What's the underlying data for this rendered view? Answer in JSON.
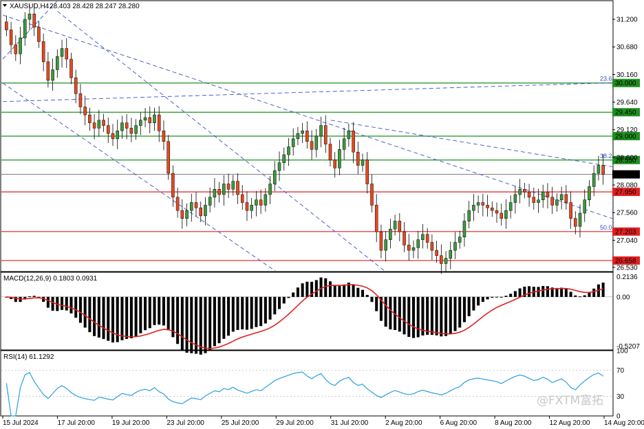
{
  "header": {
    "symbol": "XAUSUD,H4",
    "ohlc": "28.403 28.428 28.247 28.280"
  },
  "watermark": "@FXTM富拓",
  "colors": {
    "bull": "#3c9a3c",
    "bear": "#e8491f",
    "horizontal_line": "#e02020",
    "green_level": "#1f8f1f",
    "trend_dash": "#3a4fc8",
    "macd_signal": "#e02020",
    "rsi_line": "#2a9fe0"
  },
  "chart_data": [
    {
      "type": "candlestick",
      "panel": "price",
      "ylim": [
        26.45,
        31.55
      ],
      "price_ticks": [
        "31.200",
        "30.680",
        "30.160",
        "29.640",
        "29.120",
        "28.600",
        "28.080",
        "27.560",
        "27.040",
        "26.530"
      ],
      "x_labels": [
        "15 Jul 2024",
        "17 Jul 20:00",
        "19 Jul 20:00",
        "23 Jul 20:00",
        "25 Jul 20:00",
        "29 Jul 20:00",
        "31 Jul 20:00",
        "2 Aug 20:00",
        "6 Aug 20:00",
        "8 Aug 20:00",
        "12 Aug 20:00",
        "14 Aug 20:00"
      ],
      "current_price": {
        "value": 28.28,
        "label": "28.280"
      },
      "levels": [
        {
          "value": 30.0,
          "label": "30.000",
          "color": "green",
          "note": "23.6"
        },
        {
          "value": 29.45,
          "label": "29.450",
          "color": "green"
        },
        {
          "value": 29.0,
          "label": "29.000",
          "color": "green"
        },
        {
          "value": 28.55,
          "label": "28.550",
          "color": "green",
          "note": "38.2"
        },
        {
          "value": 27.95,
          "label": "27.950",
          "color": "red"
        },
        {
          "value": 27.203,
          "label": "27.203",
          "color": "red",
          "note": "50.0"
        },
        {
          "value": 26.658,
          "label": "26.658",
          "color": "red"
        }
      ],
      "candle_closes": [
        31.0,
        30.72,
        30.55,
        30.85,
        31.2,
        31.3,
        31.05,
        30.78,
        30.4,
        30.05,
        30.25,
        30.5,
        30.65,
        30.45,
        30.1,
        29.8,
        29.55,
        29.4,
        29.25,
        29.15,
        29.3,
        29.2,
        29.05,
        28.95,
        29.1,
        29.25,
        29.15,
        29.05,
        29.2,
        29.3,
        29.35,
        29.25,
        29.4,
        29.1,
        28.9,
        28.3,
        27.85,
        27.6,
        27.45,
        27.6,
        27.75,
        27.65,
        27.5,
        27.7,
        27.85,
        28.0,
        27.9,
        28.1,
        28.0,
        28.15,
        27.9,
        27.75,
        27.6,
        27.7,
        27.8,
        27.7,
        27.9,
        28.1,
        28.35,
        28.5,
        28.65,
        28.8,
        28.95,
        29.05,
        29.1,
        28.9,
        28.75,
        29.0,
        29.2,
        28.85,
        28.55,
        28.4,
        28.75,
        28.95,
        29.1,
        28.7,
        28.45,
        28.55,
        28.1,
        27.7,
        27.2,
        26.85,
        27.05,
        27.25,
        27.4,
        27.2,
        26.95,
        26.85,
        26.9,
        27.05,
        27.15,
        27.0,
        26.85,
        26.75,
        26.6,
        26.7,
        26.85,
        27.0,
        27.1,
        27.4,
        27.6,
        27.7,
        27.75,
        27.7,
        27.65,
        27.6,
        27.55,
        27.45,
        27.6,
        27.75,
        27.9,
        28.0,
        27.95,
        27.85,
        27.75,
        27.8,
        27.95,
        27.85,
        27.7,
        27.8,
        27.9,
        27.75,
        27.45,
        27.3,
        27.55,
        27.8,
        28.05,
        28.3,
        28.45,
        28.28
      ],
      "trendlines": [
        {
          "from": [
            "15 Jul 2024",
            30.45
          ],
          "to": [
            "17 Jul 20:00",
            31.55
          ],
          "style": "dashed"
        },
        {
          "from": [
            "15 Jul 2024",
            29.65
          ],
          "to": [
            "14 Aug 20:00",
            30.0
          ],
          "style": "dashed"
        },
        {
          "from": [
            "15 Jul 2024",
            31.28
          ],
          "to": [
            "14 Aug 20:00",
            27.5
          ],
          "style": "dashed"
        },
        {
          "from": [
            "17 Jul 20:00",
            31.35
          ],
          "to": [
            "2 Aug 20:00",
            26.45
          ],
          "style": "dashed"
        },
        {
          "from": [
            "15 Jul 2024",
            30.0
          ],
          "to": [
            "29 Jul 20:00",
            26.45
          ],
          "style": "dashed"
        },
        {
          "from": [
            "31 Jul 20:00",
            29.3
          ],
          "to": [
            "14 Aug 20:00",
            28.45
          ],
          "style": "dashed"
        }
      ]
    },
    {
      "type": "histogram",
      "panel": "macd",
      "title": "MACD(12,26,9) 0.1803 0.0931",
      "ylim": [
        -0.56,
        0.26
      ],
      "ticks": [
        "0.2136",
        "0.00",
        "-0.5207"
      ],
      "series": [
        {
          "name": "MACD",
          "kind": "bars"
        },
        {
          "name": "Signal",
          "kind": "line"
        }
      ]
    },
    {
      "type": "line",
      "panel": "rsi",
      "title": "RSI(14) 61.1292",
      "ylim": [
        0,
        100
      ],
      "ticks": [
        "100",
        "70",
        "30",
        "0"
      ],
      "levels": [
        70,
        30
      ],
      "series": [
        {
          "name": "RSI(14)",
          "kind": "line"
        }
      ]
    }
  ]
}
